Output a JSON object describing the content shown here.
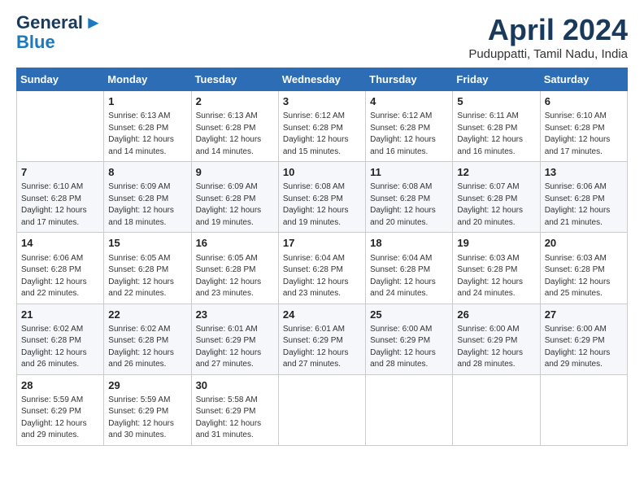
{
  "header": {
    "logo_line1": "General",
    "logo_line2": "Blue",
    "month_title": "April 2024",
    "location": "Puduppatti, Tamil Nadu, India"
  },
  "calendar": {
    "days_of_week": [
      "Sunday",
      "Monday",
      "Tuesday",
      "Wednesday",
      "Thursday",
      "Friday",
      "Saturday"
    ],
    "weeks": [
      [
        {
          "day": "",
          "info": ""
        },
        {
          "day": "1",
          "info": "Sunrise: 6:13 AM\nSunset: 6:28 PM\nDaylight: 12 hours\nand 14 minutes."
        },
        {
          "day": "2",
          "info": "Sunrise: 6:13 AM\nSunset: 6:28 PM\nDaylight: 12 hours\nand 14 minutes."
        },
        {
          "day": "3",
          "info": "Sunrise: 6:12 AM\nSunset: 6:28 PM\nDaylight: 12 hours\nand 15 minutes."
        },
        {
          "day": "4",
          "info": "Sunrise: 6:12 AM\nSunset: 6:28 PM\nDaylight: 12 hours\nand 16 minutes."
        },
        {
          "day": "5",
          "info": "Sunrise: 6:11 AM\nSunset: 6:28 PM\nDaylight: 12 hours\nand 16 minutes."
        },
        {
          "day": "6",
          "info": "Sunrise: 6:10 AM\nSunset: 6:28 PM\nDaylight: 12 hours\nand 17 minutes."
        }
      ],
      [
        {
          "day": "7",
          "info": "Sunrise: 6:10 AM\nSunset: 6:28 PM\nDaylight: 12 hours\nand 17 minutes."
        },
        {
          "day": "8",
          "info": "Sunrise: 6:09 AM\nSunset: 6:28 PM\nDaylight: 12 hours\nand 18 minutes."
        },
        {
          "day": "9",
          "info": "Sunrise: 6:09 AM\nSunset: 6:28 PM\nDaylight: 12 hours\nand 19 minutes."
        },
        {
          "day": "10",
          "info": "Sunrise: 6:08 AM\nSunset: 6:28 PM\nDaylight: 12 hours\nand 19 minutes."
        },
        {
          "day": "11",
          "info": "Sunrise: 6:08 AM\nSunset: 6:28 PM\nDaylight: 12 hours\nand 20 minutes."
        },
        {
          "day": "12",
          "info": "Sunrise: 6:07 AM\nSunset: 6:28 PM\nDaylight: 12 hours\nand 20 minutes."
        },
        {
          "day": "13",
          "info": "Sunrise: 6:06 AM\nSunset: 6:28 PM\nDaylight: 12 hours\nand 21 minutes."
        }
      ],
      [
        {
          "day": "14",
          "info": "Sunrise: 6:06 AM\nSunset: 6:28 PM\nDaylight: 12 hours\nand 22 minutes."
        },
        {
          "day": "15",
          "info": "Sunrise: 6:05 AM\nSunset: 6:28 PM\nDaylight: 12 hours\nand 22 minutes."
        },
        {
          "day": "16",
          "info": "Sunrise: 6:05 AM\nSunset: 6:28 PM\nDaylight: 12 hours\nand 23 minutes."
        },
        {
          "day": "17",
          "info": "Sunrise: 6:04 AM\nSunset: 6:28 PM\nDaylight: 12 hours\nand 23 minutes."
        },
        {
          "day": "18",
          "info": "Sunrise: 6:04 AM\nSunset: 6:28 PM\nDaylight: 12 hours\nand 24 minutes."
        },
        {
          "day": "19",
          "info": "Sunrise: 6:03 AM\nSunset: 6:28 PM\nDaylight: 12 hours\nand 24 minutes."
        },
        {
          "day": "20",
          "info": "Sunrise: 6:03 AM\nSunset: 6:28 PM\nDaylight: 12 hours\nand 25 minutes."
        }
      ],
      [
        {
          "day": "21",
          "info": "Sunrise: 6:02 AM\nSunset: 6:28 PM\nDaylight: 12 hours\nand 26 minutes."
        },
        {
          "day": "22",
          "info": "Sunrise: 6:02 AM\nSunset: 6:28 PM\nDaylight: 12 hours\nand 26 minutes."
        },
        {
          "day": "23",
          "info": "Sunrise: 6:01 AM\nSunset: 6:29 PM\nDaylight: 12 hours\nand 27 minutes."
        },
        {
          "day": "24",
          "info": "Sunrise: 6:01 AM\nSunset: 6:29 PM\nDaylight: 12 hours\nand 27 minutes."
        },
        {
          "day": "25",
          "info": "Sunrise: 6:00 AM\nSunset: 6:29 PM\nDaylight: 12 hours\nand 28 minutes."
        },
        {
          "day": "26",
          "info": "Sunrise: 6:00 AM\nSunset: 6:29 PM\nDaylight: 12 hours\nand 28 minutes."
        },
        {
          "day": "27",
          "info": "Sunrise: 6:00 AM\nSunset: 6:29 PM\nDaylight: 12 hours\nand 29 minutes."
        }
      ],
      [
        {
          "day": "28",
          "info": "Sunrise: 5:59 AM\nSunset: 6:29 PM\nDaylight: 12 hours\nand 29 minutes."
        },
        {
          "day": "29",
          "info": "Sunrise: 5:59 AM\nSunset: 6:29 PM\nDaylight: 12 hours\nand 30 minutes."
        },
        {
          "day": "30",
          "info": "Sunrise: 5:58 AM\nSunset: 6:29 PM\nDaylight: 12 hours\nand 31 minutes."
        },
        {
          "day": "",
          "info": ""
        },
        {
          "day": "",
          "info": ""
        },
        {
          "day": "",
          "info": ""
        },
        {
          "day": "",
          "info": ""
        }
      ]
    ]
  }
}
